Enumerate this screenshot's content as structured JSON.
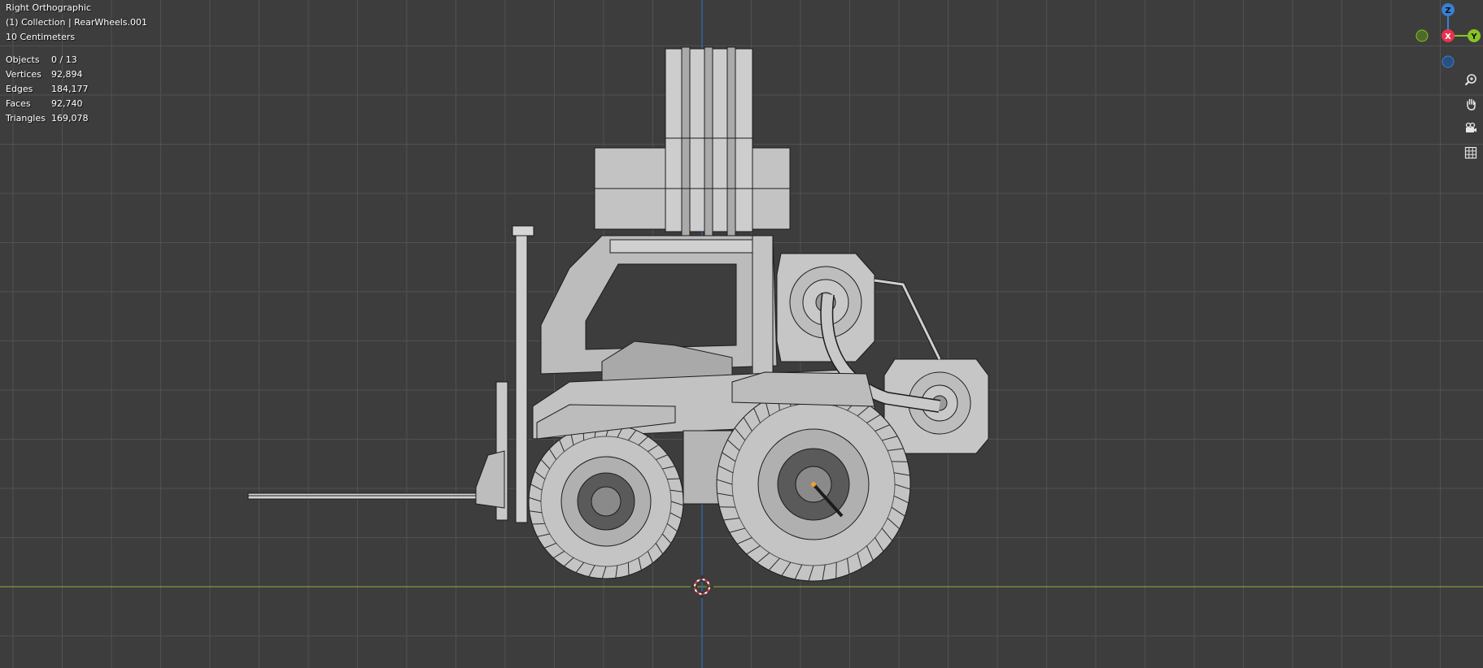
{
  "viewport": {
    "view_name": "Right Orthographic",
    "collection": "(1) Collection | RearWheels.001",
    "grid_scale": "10 Centimeters"
  },
  "stats": [
    {
      "label": "Objects",
      "value": "0 / 13"
    },
    {
      "label": "Vertices",
      "value": "92,894"
    },
    {
      "label": "Edges",
      "value": "184,177"
    },
    {
      "label": "Faces",
      "value": "92,740"
    },
    {
      "label": "Triangles",
      "value": "169,078"
    }
  ],
  "gizmo": {
    "z_label": "Z",
    "x_label": "X",
    "y_label": "Y",
    "colors": {
      "x": "#e8324e",
      "y": "#86c325",
      "z": "#3a7fd4"
    }
  },
  "nav_buttons": [
    {
      "name": "zoom-icon"
    },
    {
      "name": "pan-hand-icon"
    },
    {
      "name": "camera-icon"
    },
    {
      "name": "grid-icon"
    }
  ],
  "colors": {
    "background": "#3d3d3d",
    "grid_minor": "#474747",
    "grid_major": "#515151",
    "axis_y_horizontal": "#7d9a3a",
    "axis_z_vertical": "#2e6fb8",
    "mesh": "#cfcfcf",
    "wire": "#1a1a1a"
  }
}
